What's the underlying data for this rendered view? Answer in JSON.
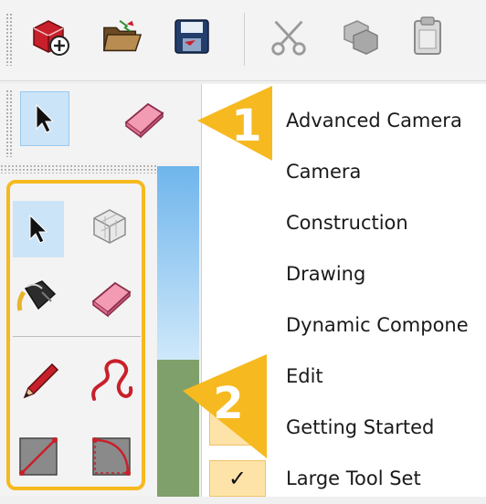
{
  "menu": {
    "items": [
      {
        "label": "Advanced Camera",
        "checked": false
      },
      {
        "label": "Camera",
        "checked": false
      },
      {
        "label": "Construction",
        "checked": false
      },
      {
        "label": "Drawing",
        "checked": false
      },
      {
        "label": "Dynamic Compone",
        "checked": false
      },
      {
        "label": "Edit",
        "checked": false
      },
      {
        "label": "Getting Started",
        "checked": true
      },
      {
        "label": "Large Tool Set",
        "checked": true
      }
    ],
    "check_glyph": "✓"
  },
  "callouts": {
    "one": "1",
    "two": "2",
    "color": "#f6b91f"
  },
  "toolbar_icons": [
    "new-model-icon",
    "open-folder-icon",
    "save-disk-icon",
    "cut-scissors-icon",
    "copy-icon",
    "paste-icon"
  ],
  "colors": {
    "selected_bg": "#cce4f7",
    "check_bg": "#fde3a8",
    "accent": "#f6b91f"
  }
}
